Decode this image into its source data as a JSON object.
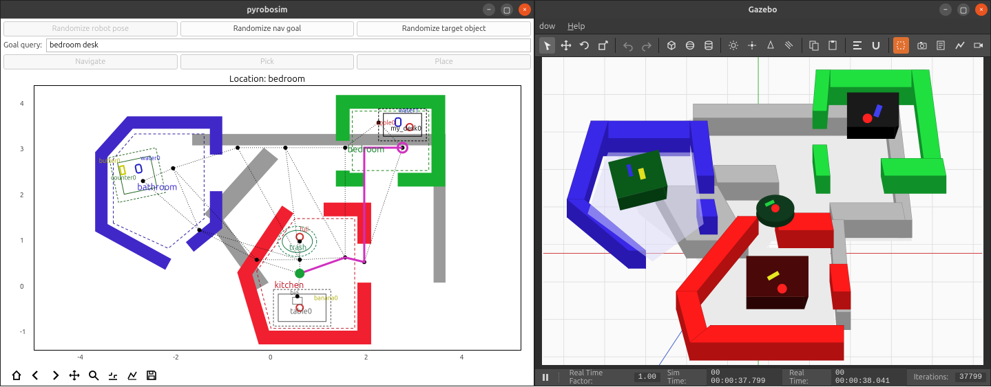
{
  "left": {
    "title": "pyrobosim",
    "buttons": {
      "randomize_pose": "Randomize robot pose",
      "randomize_nav": "Randomize nav goal",
      "randomize_obj": "Randomize target object",
      "navigate": "Navigate",
      "pick": "Pick",
      "place": "Place"
    },
    "goal_query_label": "Goal query:",
    "goal_query_value": "bedroom desk",
    "plot_title": "Location: bedroom",
    "rooms": {
      "bathroom": "bathroom",
      "bedroom": "bedroom",
      "kitchen": "kitchen"
    },
    "objects": {
      "counter": "counter0",
      "butter": "butter0",
      "water0": "water0",
      "water1": "water1",
      "my_desk": "my_desk0",
      "apple": "apple0",
      "fuji": "fuji",
      "trash": "trash",
      "bin": "bin",
      "table": "table0",
      "banana": "banana0"
    },
    "axes": {
      "x_ticks": [
        "-4",
        "-2",
        "0",
        "2",
        "4"
      ],
      "y_ticks": [
        "-1",
        "0",
        "1",
        "2",
        "3",
        "4"
      ]
    },
    "mpl_icons": [
      "home",
      "back",
      "forward",
      "pan",
      "zoom",
      "subplots",
      "figopts",
      "save"
    ]
  },
  "right": {
    "title": "Gazebo",
    "menu": {
      "window_suffix": "dow",
      "help": "Help"
    },
    "toolbar_icons": [
      "arrow",
      "move",
      "refresh",
      "scale",
      "undo",
      "redo",
      "box",
      "sphere",
      "cylinder",
      "sun",
      "sun2",
      "light",
      "plane",
      "layers",
      "copy",
      "paste",
      "align",
      "magnet",
      "cursor",
      "camera",
      "log",
      "graph",
      "video"
    ],
    "status": {
      "rtf_label": "Real Time Factor:",
      "rtf_value": "1.00",
      "sim_label": "Sim Time:",
      "sim_value": "00 00:00:37.799",
      "real_label": "Real Time:",
      "real_value": "00 00:00:38.041",
      "iter_label": "Iterations:",
      "iter_value": "37799"
    }
  },
  "colors": {
    "blue_wall": "#4028c8",
    "green_wall": "#18b030",
    "red_wall": "#f02030",
    "gray_wall": "#9a9a9a",
    "accent_orange": "#e95420"
  },
  "chart_data": {
    "type": "map",
    "title": "Location: bedroom",
    "xlim": [
      -5,
      5.2
    ],
    "ylim": [
      -1.4,
      4.4
    ],
    "rooms": [
      {
        "name": "bathroom",
        "color": "#4028c8",
        "center": [
          -2.6,
          2.2
        ]
      },
      {
        "name": "bedroom",
        "color": "#18b030",
        "center": [
          2.4,
          3.2
        ]
      },
      {
        "name": "kitchen",
        "color": "#f02030",
        "center": [
          0.6,
          0.2
        ]
      }
    ],
    "furniture": [
      {
        "name": "counter0",
        "room": "bathroom",
        "pos": [
          -2.9,
          2.4
        ]
      },
      {
        "name": "my_desk0",
        "room": "bedroom",
        "pos": [
          2.7,
          3.55
        ]
      },
      {
        "name": "trash",
        "room": "kitchen",
        "pos": [
          0.5,
          1.0
        ]
      },
      {
        "name": "table0",
        "room": "kitchen",
        "pos": [
          0.55,
          -0.45
        ]
      }
    ],
    "objects": [
      {
        "name": "butter0",
        "pos": [
          -3.15,
          2.55
        ],
        "color": "yellow"
      },
      {
        "name": "water0",
        "pos": [
          -2.8,
          2.55
        ],
        "color": "blue"
      },
      {
        "name": "water1",
        "pos": [
          2.6,
          3.6
        ],
        "color": "blue"
      },
      {
        "name": "apple0",
        "pos": [
          2.4,
          3.5
        ],
        "color": "red"
      },
      {
        "name": "fuji",
        "pos": [
          0.55,
          1.1
        ],
        "color": "red"
      },
      {
        "name": "banana0",
        "pos": [
          0.95,
          -0.3
        ],
        "color": "yellow"
      },
      {
        "name": "bin",
        "pos": [
          0.5,
          -0.3
        ],
        "color": "gray"
      }
    ],
    "robot_pos": [
      0.55,
      0.3
    ],
    "goal_pos": [
      2.7,
      3.05
    ],
    "graph_nodes": [
      [
        -2.73,
        2.32
      ],
      [
        -2.1,
        2.6
      ],
      [
        -0.75,
        3.05
      ],
      [
        0.25,
        3.05
      ],
      [
        1.5,
        3.05
      ],
      [
        2.2,
        3.6
      ],
      [
        2.7,
        3.05
      ],
      [
        -1.55,
        1.25
      ],
      [
        -0.35,
        0.6
      ],
      [
        0.55,
        0.6
      ],
      [
        0.55,
        0.3
      ],
      [
        1.5,
        0.65
      ],
      [
        1.9,
        0.55
      ],
      [
        0.55,
        1.0
      ],
      [
        0.5,
        -0.2
      ]
    ],
    "graph_edges": [
      [
        0,
        1
      ],
      [
        1,
        2
      ],
      [
        2,
        3
      ],
      [
        3,
        4
      ],
      [
        4,
        5
      ],
      [
        4,
        6
      ],
      [
        5,
        6
      ],
      [
        0,
        7
      ],
      [
        1,
        7
      ],
      [
        7,
        8
      ],
      [
        8,
        9
      ],
      [
        9,
        10
      ],
      [
        9,
        11
      ],
      [
        11,
        12
      ],
      [
        12,
        6
      ],
      [
        2,
        9
      ],
      [
        3,
        9
      ],
      [
        3,
        11
      ],
      [
        4,
        11
      ],
      [
        9,
        13
      ],
      [
        10,
        14
      ],
      [
        7,
        9
      ],
      [
        8,
        10
      ],
      [
        1,
        8
      ]
    ],
    "path": [
      [
        0.55,
        0.3
      ],
      [
        1.5,
        0.65
      ],
      [
        1.9,
        0.55
      ],
      [
        1.9,
        3.05
      ],
      [
        2.7,
        3.05
      ]
    ]
  }
}
